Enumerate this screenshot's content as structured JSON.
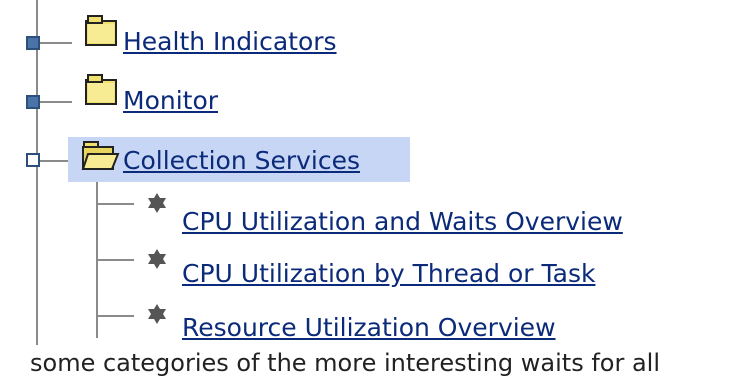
{
  "tree": {
    "nodes": [
      {
        "label": "Health Indicators",
        "state": "collapsed",
        "icon": "folder-closed-icon"
      },
      {
        "label": "Monitor",
        "state": "collapsed",
        "icon": "folder-closed-icon"
      },
      {
        "label": "Collection Services",
        "state": "expanded",
        "icon": "folder-open-icon",
        "selected": true
      }
    ],
    "children": [
      {
        "label": "CPU Utilization and Waits Overview",
        "icon": "bullet-icon"
      },
      {
        "label": "CPU Utilization by Thread or Task",
        "icon": "bullet-icon"
      },
      {
        "label": "Resource Utilization Overview",
        "icon": "bullet-icon"
      }
    ]
  },
  "body_text": "some categories of the more interesting waits for all",
  "colors": {
    "link": "#0b2a7a",
    "selection": "#c8d6f5",
    "expander_fill": "#4a73a8",
    "folder": "#f0e070"
  }
}
